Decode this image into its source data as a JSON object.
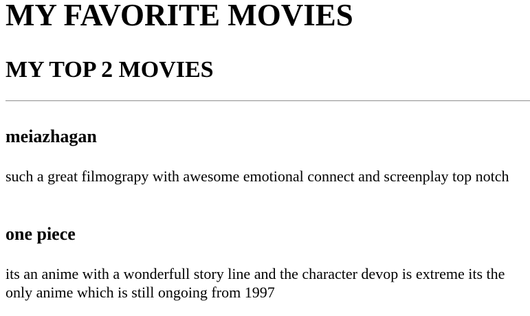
{
  "header": {
    "title": "MY FAVORITE MOVIES",
    "subtitle": "MY TOP 2 MOVIES"
  },
  "movies": [
    {
      "title": "meiazhagan",
      "description": "such a great filmograpy with awesome emotional connect and screenplay top notch"
    },
    {
      "title": "one piece",
      "description": "its an anime with a wonderfull story line and the character devop is extreme its the only anime which is still ongoing from 1997"
    }
  ]
}
